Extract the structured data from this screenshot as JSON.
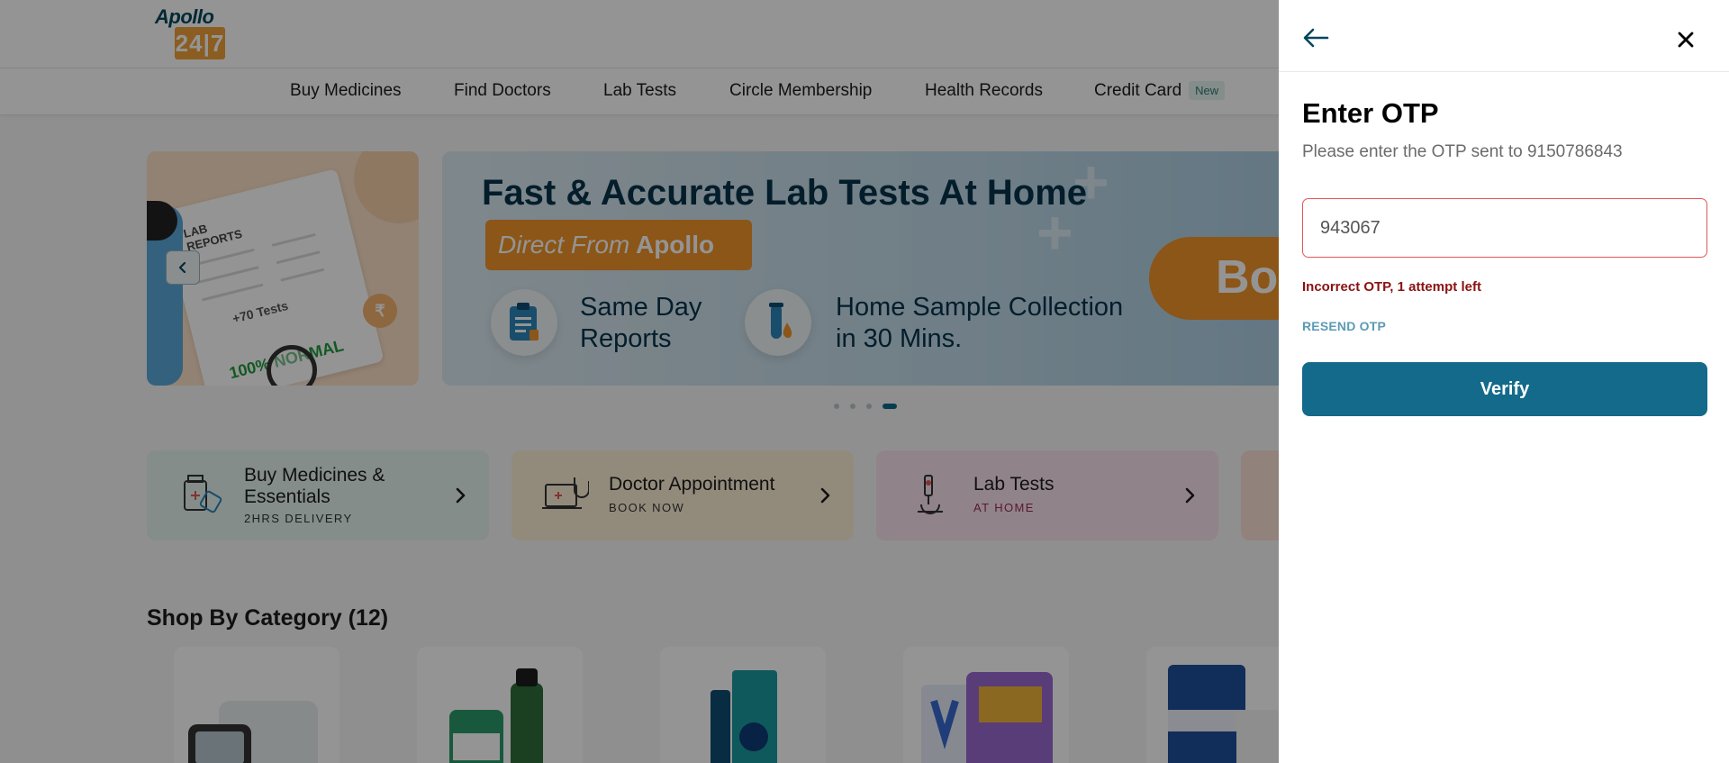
{
  "header": {
    "logo_top": "Apollo",
    "logo_box": "24|7"
  },
  "nav": {
    "items": [
      "Buy Medicines",
      "Find Doctors",
      "Lab Tests",
      "Circle Membership",
      "Health Records",
      "Credit Card"
    ],
    "credit_card_badge": "New"
  },
  "banner_left": {
    "report_title": "LAB\nREPORTS",
    "tests": "+70 Tests",
    "normal": "100% NORMAL"
  },
  "banner_main": {
    "title": "Fast & Accurate Lab Tests At Home",
    "tag_italic": "Direct From",
    "tag_brand": "Apollo",
    "feature1": "Same Day Reports",
    "feature2": "Home Sample Collection in 30 Mins.",
    "cta_partial": "Bo"
  },
  "carousel": {
    "dot_count": 4,
    "active_dot": 4
  },
  "services": [
    {
      "title": "Buy Medicines & Essentials",
      "subtitle": "2HRS DELIVERY",
      "bg": "#e3f3ee",
      "accent": "#1c1c1c"
    },
    {
      "title": "Doctor Appointment",
      "subtitle": "BOOK NOW",
      "bg": "#fcefd6",
      "accent": "#1c1c1c"
    },
    {
      "title": "Lab Tests",
      "subtitle": "AT HOME",
      "bg": "#f8e2ec",
      "accent": "#9a2a57"
    }
  ],
  "category": {
    "title": "Shop By Category (12)"
  },
  "otp_panel": {
    "title": "Enter OTP",
    "subtitle": "Please enter the OTP sent to 9150786843",
    "otp_value": "943067",
    "error": "Incorrect OTP, 1 attempt left",
    "resend_label": "RESEND OTP",
    "verify_label": "Verify"
  },
  "colors": {
    "primary": "#136a8a",
    "accent_orange": "#f0952a",
    "error": "#8a1212",
    "input_border_error": "#e25757"
  }
}
